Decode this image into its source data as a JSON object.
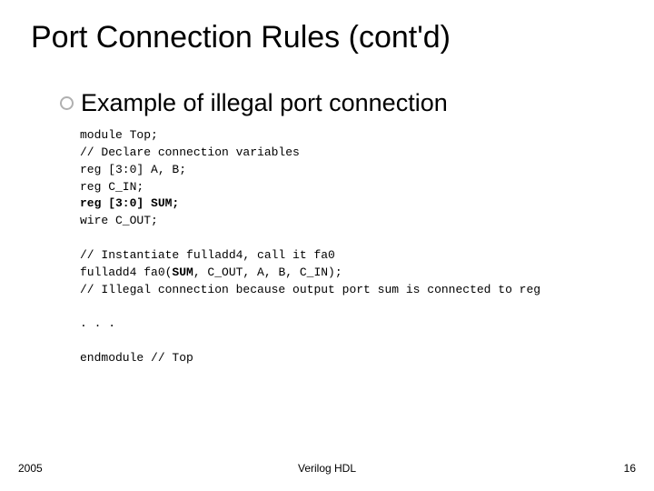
{
  "title": "Port Connection Rules (cont'd)",
  "bullet": "Example of illegal port connection",
  "code": {
    "l01": "module Top;",
    "l02": "// Declare connection variables",
    "l03": "reg [3:0] A, B;",
    "l04": "reg C_IN;",
    "l05": "reg [3:0] SUM;",
    "l06": "wire C_OUT;",
    "l07": "",
    "l08": "// Instantiate fulladd4, call it fa0",
    "l09a": "fulladd4 fa0(",
    "l09b": "SUM",
    "l09c": ", C_OUT, A, B, C_IN);",
    "l10": "// Illegal connection because output port sum is connected to reg",
    "l11": "",
    "l12": ". . .",
    "l13": "",
    "l14": "endmodule // Top"
  },
  "footer": {
    "year": "2005",
    "center": "Verilog HDL",
    "page": "16"
  }
}
